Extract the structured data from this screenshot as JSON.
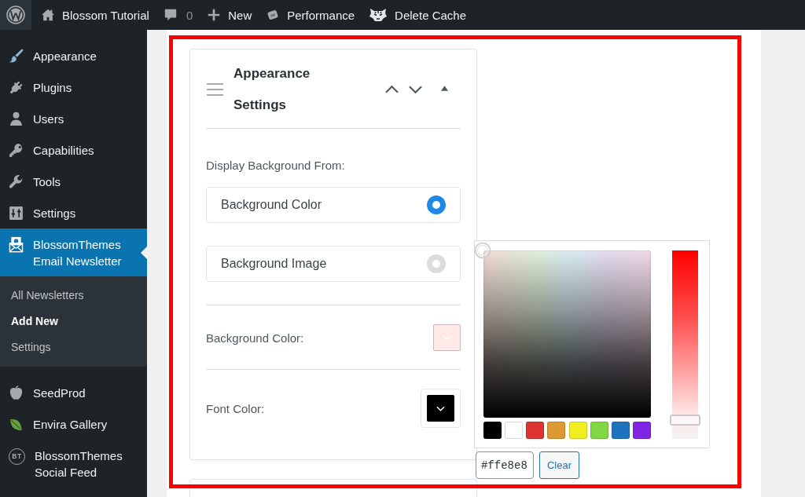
{
  "admin_bar": {
    "items": [
      {
        "label": "Blossom Tutorial"
      },
      {
        "label": "0"
      },
      {
        "label": "New"
      },
      {
        "label": "Performance"
      },
      {
        "label": "Delete Cache"
      }
    ]
  },
  "sidebar": {
    "items": [
      {
        "label": "Appearance",
        "selected": false
      },
      {
        "label": "Plugins",
        "selected": false
      },
      {
        "label": "Users",
        "selected": false
      },
      {
        "label": "Capabilities",
        "selected": false
      },
      {
        "label": "Tools",
        "selected": false
      },
      {
        "label": "Settings",
        "selected": false
      },
      {
        "label": "BlossomThemes Email Newsletter",
        "selected": true,
        "children": [
          {
            "label": "All Newsletters",
            "selected": false
          },
          {
            "label": "Add New",
            "selected": true
          },
          {
            "label": "Settings",
            "selected": false
          }
        ]
      },
      {
        "label": "SeedProd",
        "selected": false
      },
      {
        "label": "Envira Gallery",
        "selected": false
      },
      {
        "label": "BlossomThemes Social Feed",
        "selected": false,
        "icon_text": "BT"
      }
    ]
  },
  "panel": {
    "title": "Appearance Settings",
    "prompt": "Display Background From:",
    "options": [
      {
        "label": "Background Color",
        "selected": true
      },
      {
        "label": "Background Image",
        "selected": false
      }
    ],
    "color_fields": [
      {
        "label": "Background Color:",
        "color": "#ffe8e8",
        "open": true
      },
      {
        "label": "Font Color:",
        "color": "#000000",
        "open": false
      }
    ]
  },
  "color_picker": {
    "palette": [
      {
        "color": "#000000"
      },
      {
        "color": "#ffffff"
      },
      {
        "color": "#dd3333"
      },
      {
        "color": "#dd9933"
      },
      {
        "color": "#eeee22"
      },
      {
        "color": "#81d742"
      },
      {
        "color": "#1e73be"
      },
      {
        "color": "#8224e3"
      }
    ],
    "level": 0.1,
    "value": "#ffe8e8",
    "clear_label": "Clear"
  }
}
